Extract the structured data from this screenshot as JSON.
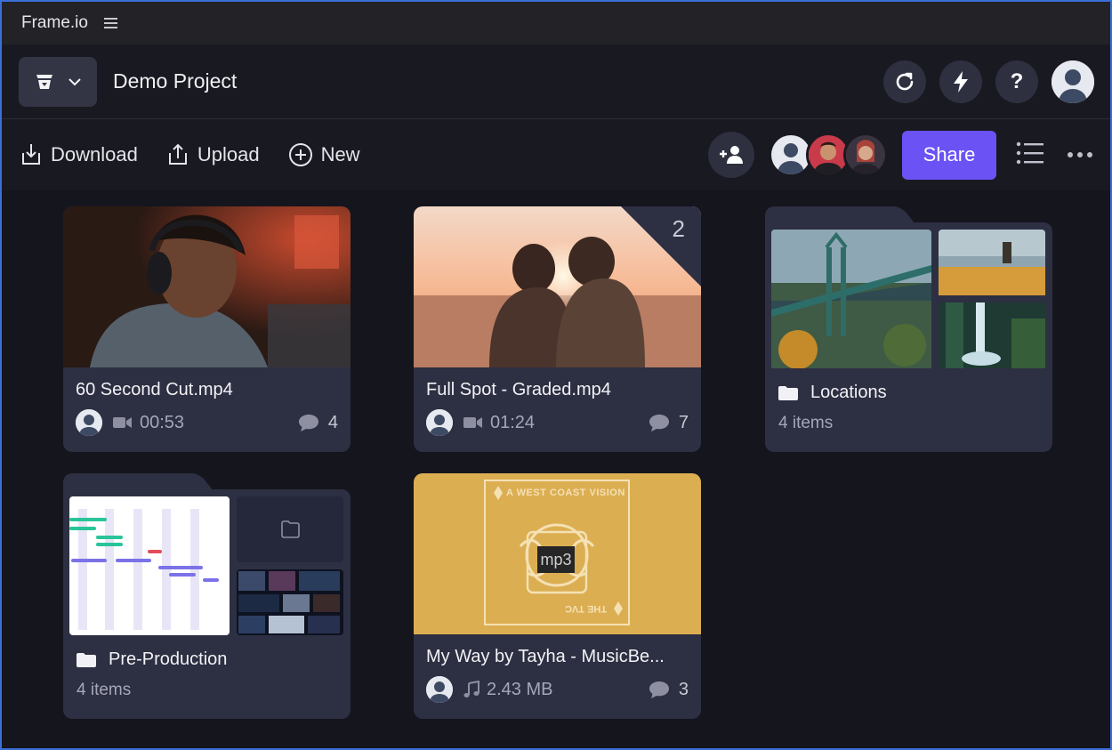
{
  "app": {
    "title": "Frame.io"
  },
  "header": {
    "project_title": "Demo Project"
  },
  "toolbar": {
    "download_label": "Download",
    "upload_label": "Upload",
    "new_label": "New",
    "share_label": "Share"
  },
  "help_label": "?",
  "cards": [
    {
      "title": "60 Second Cut.mp4",
      "duration": "00:53",
      "comments": "4",
      "type_icon": "video-icon"
    },
    {
      "title": "Full Spot - Graded.mp4",
      "duration": "01:24",
      "comments": "7",
      "version_count": "2",
      "type_icon": "video-icon"
    },
    {
      "title": "My Way by Tayha - MusicBe...",
      "size": "2.43 MB",
      "comments": "3",
      "type_icon": "music-note-icon",
      "thumb_text": "mp3",
      "art_top_text": "A WEST COAST VISION",
      "art_bottom_text": "THE TVC"
    }
  ],
  "folders": [
    {
      "name": "Locations",
      "count": "4 items"
    },
    {
      "name": "Pre-Production",
      "count": "4 items"
    }
  ],
  "colors": {
    "accent": "#6b52f5",
    "card": "#2d2f42",
    "background": "#15151d"
  }
}
